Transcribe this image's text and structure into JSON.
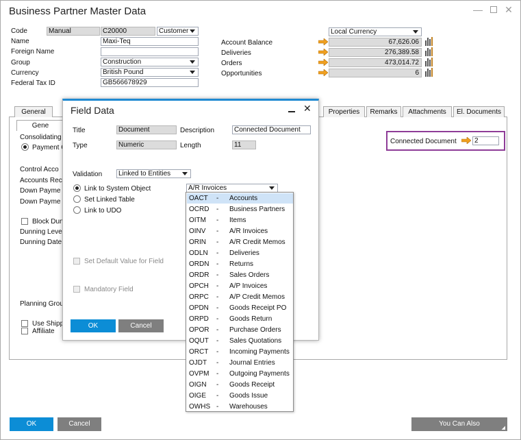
{
  "window": {
    "title": "Business Partner Master Data"
  },
  "header": {
    "code_label": "Code",
    "code_series": "Manual",
    "code_value": "C20000",
    "bp_type": "Customer",
    "name_label": "Name",
    "name_value": "Maxi-Teq",
    "foreign_name_label": "Foreign Name",
    "foreign_name_value": "",
    "group_label": "Group",
    "group_value": "Construction",
    "currency_label": "Currency",
    "currency_value": "British Pound",
    "tax_label": "Federal Tax ID",
    "tax_value": "GB566678929",
    "currency_mode": "Local Currency",
    "balance_label": "Account Balance",
    "balance_value": "67,626.06",
    "deliveries_label": "Deliveries",
    "deliveries_value": "276,389.58",
    "orders_label": "Orders",
    "orders_value": "473,014.72",
    "opportunities_label": "Opportunities",
    "opportunities_value": "6"
  },
  "tabs": [
    "General",
    "Properties",
    "Remarks",
    "Attachments",
    "El. Documents"
  ],
  "general": {
    "subtab": "Gene",
    "consolidating": "Consolidating",
    "payment": "Payment C",
    "control": "Control Acco",
    "accounts_rec": "Accounts Rec",
    "down_pay1": "Down Payme",
    "down_pay2": "Down Payme",
    "block": "Block Dun",
    "dunning_level": "Dunning Leve",
    "dunning_date": "Dunning Date",
    "planning": "Planning Grou",
    "use_ship": "Use Shipp",
    "affiliate": "Affiliate",
    "connected_doc_label": "Connected Document",
    "connected_doc_value": "2"
  },
  "footer": {
    "ok": "OK",
    "cancel": "Cancel",
    "you_can_also": "You Can Also"
  },
  "dialog": {
    "title": "Field Data",
    "title_label": "Title",
    "title_value": "Document",
    "description_label": "Description",
    "description_value": "Connected Document",
    "type_label": "Type",
    "type_value": "Numeric",
    "length_label": "Length",
    "length_value": "11",
    "validation_label": "Validation",
    "validation_value": "Linked to Entities",
    "link_system": "Link to System Object",
    "link_system_value": "A/R Invoices",
    "set_linked": "Set Linked Table",
    "link_udo": "Link to UDO",
    "default_value": "Set Default Value for Field",
    "mandatory": "Mandatory Field",
    "ok": "OK",
    "cancel": "Cancel"
  },
  "object_list": [
    {
      "code": "OACT",
      "name": "Accounts"
    },
    {
      "code": "OCRD",
      "name": "Business Partners"
    },
    {
      "code": "OITM",
      "name": "Items"
    },
    {
      "code": "OINV",
      "name": "A/R Invoices"
    },
    {
      "code": "ORIN",
      "name": "A/R Credit Memos"
    },
    {
      "code": "ODLN",
      "name": "Deliveries"
    },
    {
      "code": "ORDN",
      "name": "Returns"
    },
    {
      "code": "ORDR",
      "name": "Sales Orders"
    },
    {
      "code": "OPCH",
      "name": "A/P Invoices"
    },
    {
      "code": "ORPC",
      "name": "A/P Credit Memos"
    },
    {
      "code": "OPDN",
      "name": "Goods Receipt PO"
    },
    {
      "code": "ORPD",
      "name": "Goods Return"
    },
    {
      "code": "OPOR",
      "name": "Purchase Orders"
    },
    {
      "code": "OQUT",
      "name": "Sales Quotations"
    },
    {
      "code": "ORCT",
      "name": "Incoming Payments"
    },
    {
      "code": "OJDT",
      "name": "Journal Entries"
    },
    {
      "code": "OVPM",
      "name": "Outgoing Payments"
    },
    {
      "code": "OIGN",
      "name": "Goods Receipt"
    },
    {
      "code": "OIGE",
      "name": "Goods Issue"
    },
    {
      "code": "OWHS",
      "name": "Warehouses"
    }
  ],
  "list_separator": "-",
  "colors": {
    "accent": "#1f8ad2",
    "button_blue": "#0c8dd6",
    "highlight_box": "#8e3c97",
    "arrow": "#f0a020"
  }
}
